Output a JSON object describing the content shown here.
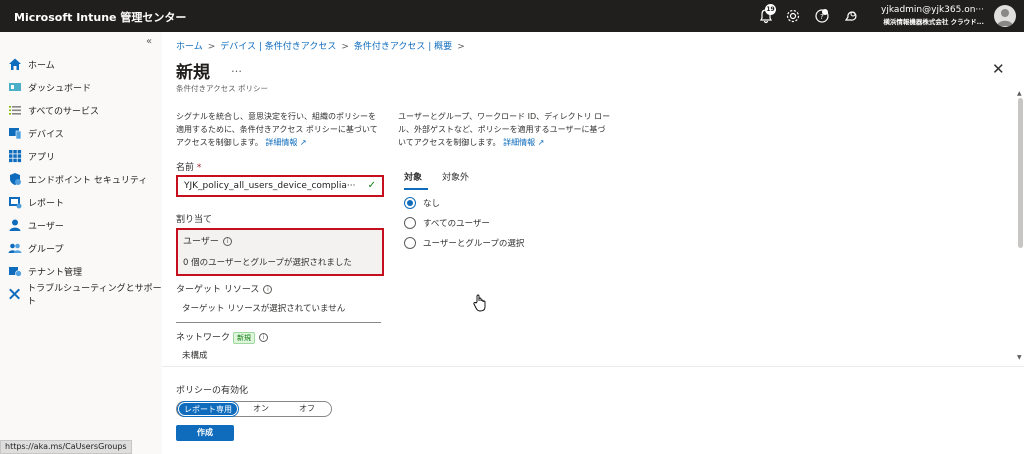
{
  "app": {
    "title": "Microsoft Intune 管理センター"
  },
  "topbar": {
    "notification_count": "19",
    "account_email": "yjkadmin@yjk365.on···",
    "account_tenant": "横浜情報機器株式会社 クラウド..."
  },
  "sidebar": {
    "items": [
      {
        "label": "ホーム",
        "icon": "home-icon"
      },
      {
        "label": "ダッシュボード",
        "icon": "dashboard-icon"
      },
      {
        "label": "すべてのサービス",
        "icon": "list-icon"
      },
      {
        "label": "デバイス",
        "icon": "devices-icon"
      },
      {
        "label": "アプリ",
        "icon": "apps-grid-icon"
      },
      {
        "label": "エンドポイント セキュリティ",
        "icon": "shield-icon"
      },
      {
        "label": "レポート",
        "icon": "reports-icon"
      },
      {
        "label": "ユーザー",
        "icon": "user-icon"
      },
      {
        "label": "グループ",
        "icon": "groups-icon"
      },
      {
        "label": "テナント管理",
        "icon": "tenant-icon"
      },
      {
        "label": "トラブルシューティングとサポート",
        "icon": "tools-icon"
      }
    ]
  },
  "breadcrumb": [
    "ホーム",
    "デバイス | 条件付きアクセス",
    "条件付きアクセス | 概要"
  ],
  "page": {
    "title": "新規",
    "more": "…",
    "subtitle": "条件付きアクセス ポリシー"
  },
  "intro_left": {
    "line1": "シグナルを統合し、意思決定を行い、組織のポリシーを",
    "line2": "適用するために、条件付きアクセス ポリシーに基づいて",
    "line3": "アクセスを制御します。",
    "link": "詳細情報"
  },
  "intro_right": {
    "line1": "ユーザーとグループ、ワークロード ID、ディレクトリ ロー",
    "line2": "ル、外部ゲストなど、ポリシーを適用するユーザーに基づ",
    "line3": "いてアクセスを制御します。",
    "link": "詳細情報"
  },
  "form": {
    "name_label": "名前",
    "required_mark": "*",
    "name_value": "YJK_policy_all_users_device_complia···",
    "assignments_heading": "割り当て",
    "users_label": "ユーザー",
    "users_value": "0 個のユーザーとグループが選択されました",
    "target_label": "ターゲット リソース",
    "target_value": "ターゲット リソースが選択されていません",
    "network_label": "ネットワーク",
    "network_badge": "新規",
    "network_value": "未構成"
  },
  "tabs": {
    "include": "対象",
    "exclude": "対象外"
  },
  "radios": [
    {
      "label": "なし",
      "selected": true
    },
    {
      "label": "すべてのユーザー",
      "selected": false
    },
    {
      "label": "ユーザーとグループの選択",
      "selected": false
    }
  ],
  "footer": {
    "enable_label": "ポリシーの有効化",
    "options": [
      "レポート専用",
      "オン",
      "オフ"
    ],
    "selected_option": "レポート専用",
    "create_button": "作成"
  },
  "status_url": "https://aka.ms/CaUsersGroups",
  "colors": {
    "accent": "#0f6cbd",
    "highlight_border": "#c50f1f",
    "topbar": "#201f1e"
  }
}
